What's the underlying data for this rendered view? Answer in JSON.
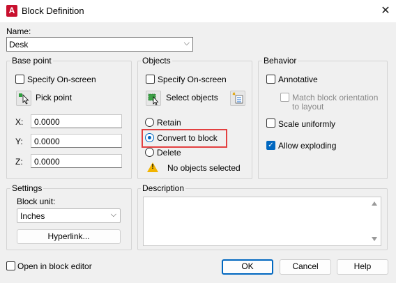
{
  "window": {
    "title": "Block Definition",
    "app_icon_letter": "A"
  },
  "name": {
    "label": "Name:",
    "value": "Desk"
  },
  "base_point": {
    "title": "Base point",
    "specify_onscreen": "Specify On-screen",
    "pick_point": "Pick point",
    "x_label": "X:",
    "x_value": "0.0000",
    "y_label": "Y:",
    "y_value": "0.0000",
    "z_label": "Z:",
    "z_value": "0.0000"
  },
  "objects": {
    "title": "Objects",
    "specify_onscreen": "Specify On-screen",
    "select_objects": "Select objects",
    "retain": "Retain",
    "convert_to_block": "Convert to block",
    "delete": "Delete",
    "status": "No objects selected"
  },
  "behavior": {
    "title": "Behavior",
    "annotative": "Annotative",
    "match_orientation_line1": "Match block orientation",
    "match_orientation_line2": "to layout",
    "scale_uniformly": "Scale uniformly",
    "allow_exploding": "Allow exploding"
  },
  "settings": {
    "title": "Settings",
    "block_unit_label": "Block unit:",
    "block_unit_value": "Inches",
    "hyperlink": "Hyperlink..."
  },
  "description": {
    "title": "Description"
  },
  "footer": {
    "open_in_editor": "Open in block editor",
    "ok": "OK",
    "cancel": "Cancel",
    "help": "Help"
  },
  "colors": {
    "accent": "#0067c0",
    "highlight": "#e34040",
    "warning": "#f2b400",
    "app_icon": "#c8102e"
  }
}
